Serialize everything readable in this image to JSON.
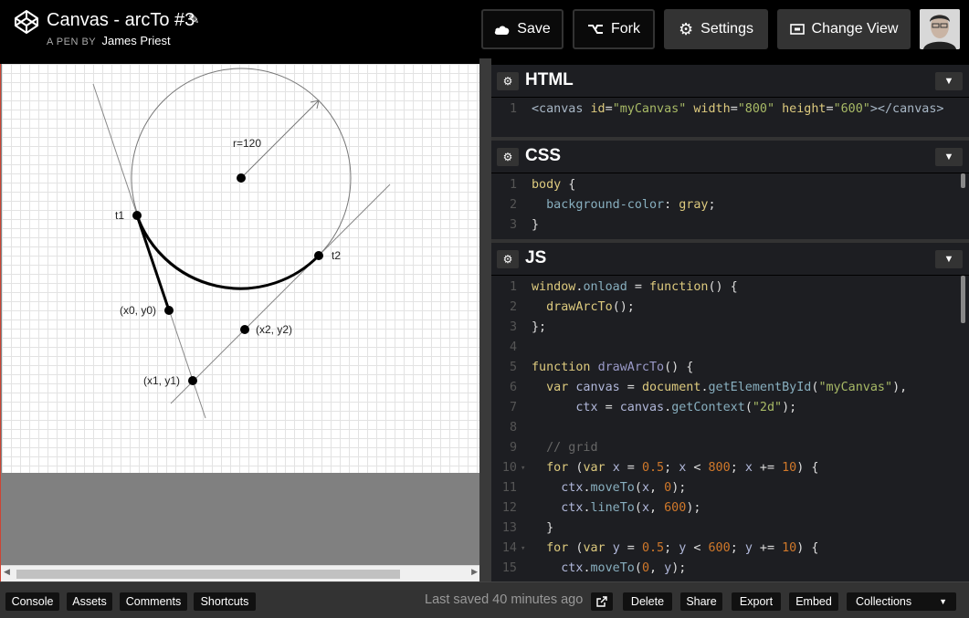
{
  "header": {
    "title": "Canvas - arcTo #3",
    "byline_prefix": "A PEN BY",
    "author": "James Priest",
    "save_label": "Save",
    "fork_label": "Fork",
    "settings_label": "Settings",
    "change_view_label": "Change View"
  },
  "canvas": {
    "labels": {
      "radius": "r=120",
      "t1": "t1",
      "t2": "t2",
      "p0": "(x0, y0)",
      "p1": "(x1, y1)",
      "p2": "(x2, y2)"
    }
  },
  "editors": {
    "html": {
      "title": "HTML",
      "lines": [
        {
          "n": "1",
          "text": "<canvas id=\"myCanvas\" width=\"800\" height=\"600\"></canvas>"
        }
      ]
    },
    "css": {
      "title": "CSS",
      "lines": [
        {
          "n": "1",
          "text": "body {"
        },
        {
          "n": "2",
          "text": "  background-color: gray;"
        },
        {
          "n": "3",
          "text": "}"
        }
      ]
    },
    "js": {
      "title": "JS",
      "lines": [
        {
          "n": "1",
          "text": "window.onload = function() {"
        },
        {
          "n": "2",
          "text": "  drawArcTo();"
        },
        {
          "n": "3",
          "text": "};"
        },
        {
          "n": "4",
          "text": ""
        },
        {
          "n": "5",
          "text": "function drawArcTo() {"
        },
        {
          "n": "6",
          "text": "  var canvas = document.getElementById(\"myCanvas\"),"
        },
        {
          "n": "7",
          "text": "      ctx = canvas.getContext(\"2d\");"
        },
        {
          "n": "8",
          "text": ""
        },
        {
          "n": "9",
          "text": "  // grid"
        },
        {
          "n": "10",
          "text": "  for (var x = 0.5; x < 800; x += 10) {"
        },
        {
          "n": "11",
          "text": "    ctx.moveTo(x, 0);"
        },
        {
          "n": "12",
          "text": "    ctx.lineTo(x, 600);"
        },
        {
          "n": "13",
          "text": "  }"
        },
        {
          "n": "14",
          "text": "  for (var y = 0.5; y < 600; y += 10) {"
        },
        {
          "n": "15",
          "text": "    ctx.moveTo(0, y);"
        }
      ]
    }
  },
  "footer": {
    "console": "Console",
    "assets": "Assets",
    "comments": "Comments",
    "shortcuts": "Shortcuts",
    "last_saved": "Last saved 40 minutes ago",
    "delete": "Delete",
    "share": "Share",
    "export": "Export",
    "embed": "Embed",
    "collections": "Collections"
  },
  "icons": {
    "logo": "codepen-logo-icon",
    "edit": "pencil-icon",
    "save": "cloud-icon",
    "fork": "fork-icon",
    "settings": "gear-icon",
    "change_view": "layout-icon",
    "external": "external-link-icon"
  }
}
